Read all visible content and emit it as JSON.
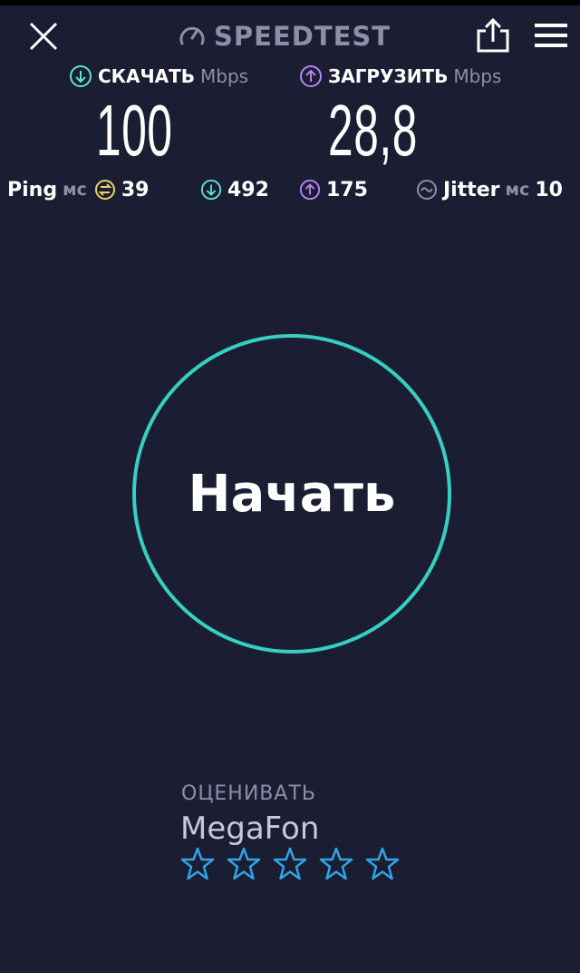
{
  "header": {
    "brand": "SPEEDTEST",
    "icons": {
      "close": "close-icon",
      "brand": "gauge-icon",
      "share": "share-icon",
      "menu": "menu-icon"
    }
  },
  "download": {
    "label": "СКАЧАТЬ",
    "unit": "Mbps",
    "value": "100",
    "icon": "arrow-down-circle-icon"
  },
  "upload": {
    "label": "ЗАГРУЗИТЬ",
    "unit": "Mbps",
    "value": "28,8",
    "icon": "arrow-up-circle-icon"
  },
  "stats": {
    "ping": {
      "label": "Ping",
      "unit": "мс",
      "value": "39"
    },
    "download_latency": {
      "value": "492"
    },
    "upload_latency": {
      "value": "175"
    },
    "jitter": {
      "label": "Jitter",
      "unit": "мс",
      "value": "10"
    }
  },
  "start_button": {
    "label": "Начать"
  },
  "rating": {
    "label": "ОЦЕНИВАТЬ",
    "provider": "MegaFon",
    "stars_total": 5,
    "stars_selected": 0
  },
  "colors": {
    "background": "#1b1d32",
    "accent_teal": "#35d0c2",
    "download": "#5ee4d3",
    "upload": "#b884f5",
    "ping": "#e9d36a",
    "muted": "#8c8fa6",
    "star": "#2fa5e6"
  }
}
